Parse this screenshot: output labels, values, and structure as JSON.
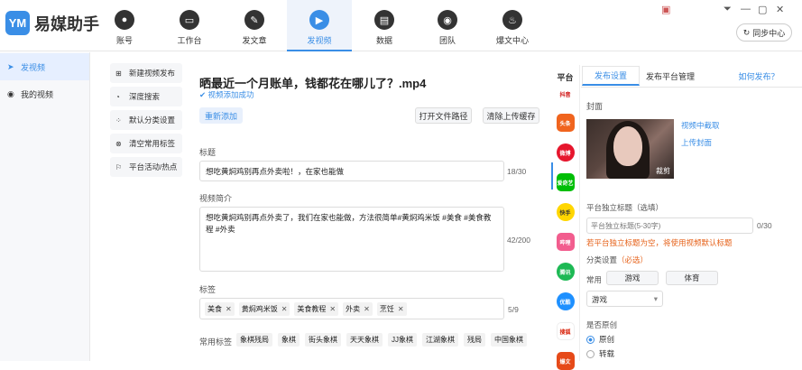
{
  "app": {
    "name": "易媒助手",
    "logo_mark": "YM"
  },
  "nav": [
    {
      "label": "账号",
      "icon": "person-icon"
    },
    {
      "label": "工作台",
      "icon": "monitor-icon"
    },
    {
      "label": "发文章",
      "icon": "pen-icon"
    },
    {
      "label": "发视频",
      "icon": "play-icon"
    },
    {
      "label": "数据",
      "icon": "chart-icon"
    },
    {
      "label": "团队",
      "icon": "team-icon"
    },
    {
      "label": "爆文中心",
      "icon": "fire-icon"
    }
  ],
  "window": {
    "sync_label": "同步中心"
  },
  "sidebar": {
    "items": [
      {
        "label": "发视频"
      },
      {
        "label": "我的视频"
      }
    ]
  },
  "submenu": {
    "items": [
      {
        "label": "新建视频发布"
      },
      {
        "label": "深度搜索"
      },
      {
        "label": "默认分类设置"
      },
      {
        "label": "清空常用标签"
      },
      {
        "label": "平台活动/热点"
      }
    ]
  },
  "video": {
    "filename": "晒最近一个月账单，钱都花在哪儿了？.mp4",
    "status": "视频添加成功",
    "readd_label": "重新添加",
    "open_path_label": "打开文件路径",
    "clear_label": "清除上传缓存"
  },
  "form": {
    "title_label": "标题",
    "title_value": "想吃黄焖鸡别再点外卖啦！，在家也能做",
    "title_count": "18/30",
    "intro_label": "视频简介",
    "intro_value": "想吃黄焖鸡别再点外卖了，我们在家也能做，方法很简单#黄焖鸡米饭 #美食 #美食教程 #外卖",
    "intro_count": "42/200",
    "tags_label": "标签",
    "tags": [
      "美食",
      "黄焖鸡米饭",
      "美食教程",
      "外卖",
      "烹饪"
    ],
    "tags_count": "5/9",
    "common_tags_label": "常用标签",
    "common_tags": [
      "象棋残局",
      "象棋",
      "街头象棋",
      "天天象棋",
      "JJ象棋",
      "江湖象棋",
      "残局",
      "中国象棋"
    ]
  },
  "platforms": {
    "label": "平台",
    "items": [
      "抖音",
      "头条",
      "微博",
      "爱奇艺",
      "快手",
      "哔哩",
      "腾讯",
      "优酷",
      "搜狐",
      "爆文"
    ]
  },
  "right": {
    "tabs": [
      "发布设置",
      "发布平台管理"
    ],
    "help_link": "如何发布？",
    "cover_label": "封面",
    "cover_crop": "裁剪",
    "cover_capture": "视频中截取",
    "cover_upload": "上传封面",
    "indep_title_label": "平台独立标题（选填）",
    "indep_title_placeholder": "平台独立标题(5-30字)",
    "indep_title_count": "0/30",
    "indep_title_warning": "若平台独立标题为空，将使用视频默认标题",
    "category_label": "分类设置",
    "category_required": "（必选）",
    "common_label": "常用",
    "category_options": [
      "游戏",
      "体育"
    ],
    "category_selected": "游戏",
    "original_label": "是否原创",
    "original_options": [
      "原创",
      "转载"
    ]
  },
  "colors": {
    "accent": "#3a8ee6",
    "warning": "#e6621a"
  }
}
